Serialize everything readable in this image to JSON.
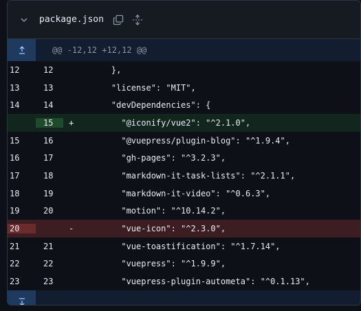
{
  "file": {
    "name": "package.json",
    "collapse_icon": "chevron-down-icon",
    "copy_icon": "copy-icon",
    "expand_icon": "unfold-icon"
  },
  "hunk": {
    "header": "@@ -12,12 +12,12 @@",
    "expand_up_icon": "expand-up-icon",
    "expand_down_icon": "expand-down-icon"
  },
  "rows": [
    {
      "old": "12",
      "new": "12",
      "marker": "",
      "type": "context",
      "code": "    },"
    },
    {
      "old": "13",
      "new": "13",
      "marker": "",
      "type": "context",
      "code": "    \"license\": \"MIT\","
    },
    {
      "old": "14",
      "new": "14",
      "marker": "",
      "type": "context",
      "code": "    \"devDependencies\": {"
    },
    {
      "old": "",
      "new": "15",
      "marker": "+",
      "type": "add",
      "code": "      \"@iconify/vue2\": \"^2.1.0\","
    },
    {
      "old": "15",
      "new": "16",
      "marker": "",
      "type": "context",
      "code": "      \"@vuepress/plugin-blog\": \"^1.9.4\","
    },
    {
      "old": "16",
      "new": "17",
      "marker": "",
      "type": "context",
      "code": "      \"gh-pages\": \"^3.2.3\","
    },
    {
      "old": "17",
      "new": "18",
      "marker": "",
      "type": "context",
      "code": "      \"markdown-it-task-lists\": \"^2.1.1\","
    },
    {
      "old": "18",
      "new": "19",
      "marker": "",
      "type": "context",
      "code": "      \"markdown-it-video\": \"^0.6.3\","
    },
    {
      "old": "19",
      "new": "20",
      "marker": "",
      "type": "context",
      "code": "      \"motion\": \"^10.14.2\","
    },
    {
      "old": "20",
      "new": "",
      "marker": "-",
      "type": "del",
      "code": "      \"vue-icon\": \"^2.3.0\","
    },
    {
      "old": "21",
      "new": "21",
      "marker": "",
      "type": "context",
      "code": "      \"vue-toastification\": \"^1.7.14\","
    },
    {
      "old": "22",
      "new": "22",
      "marker": "",
      "type": "context",
      "code": "      \"vuepress\": \"^1.9.9\","
    },
    {
      "old": "23",
      "new": "23",
      "marker": "",
      "type": "context",
      "code": "      \"vuepress-plugin-autometa\": \"^0.1.13\","
    }
  ]
}
